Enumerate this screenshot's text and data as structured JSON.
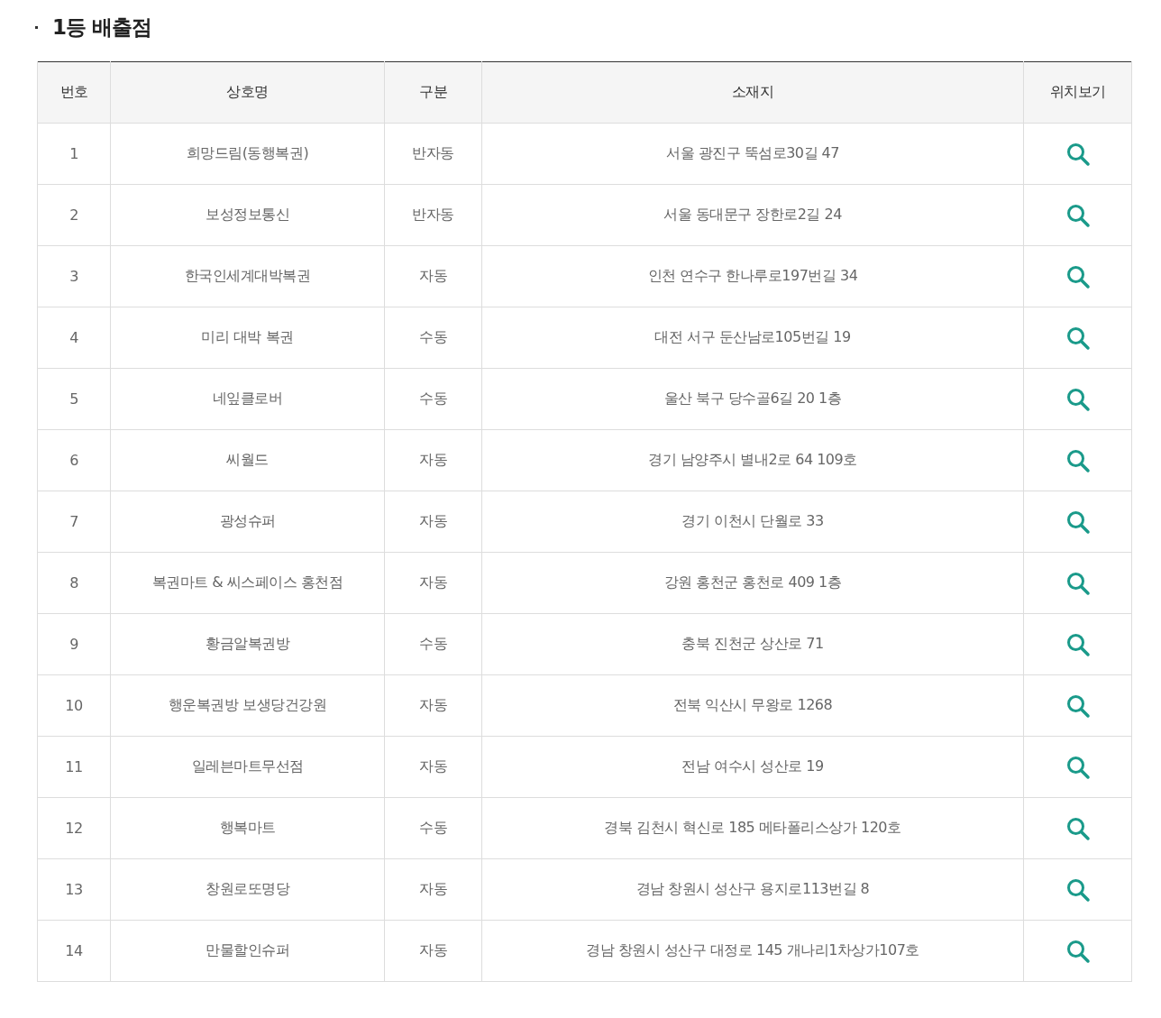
{
  "section_title": "1등 배출점",
  "table": {
    "columns": [
      "번호",
      "상호명",
      "구분",
      "소재지",
      "위치보기"
    ],
    "rows": [
      {
        "number": "1",
        "name": "희망드림(동행복권)",
        "type": "반자동",
        "address": "서울 광진구 뚝섬로30길 47"
      },
      {
        "number": "2",
        "name": "보성정보통신",
        "type": "반자동",
        "address": "서울 동대문구 장한로2길 24"
      },
      {
        "number": "3",
        "name": "한국인세계대박복권",
        "type": "자동",
        "address": "인천 연수구 한나루로197번길 34"
      },
      {
        "number": "4",
        "name": "미리 대박 복권",
        "type": "수동",
        "address": "대전 서구 둔산남로105번길 19"
      },
      {
        "number": "5",
        "name": "네잎클로버",
        "type": "수동",
        "address": "울산 북구 당수골6길 20 1층"
      },
      {
        "number": "6",
        "name": "씨월드",
        "type": "자동",
        "address": "경기 남양주시 별내2로 64 109호"
      },
      {
        "number": "7",
        "name": "광성슈퍼",
        "type": "자동",
        "address": "경기 이천시 단월로 33"
      },
      {
        "number": "8",
        "name": "복권마트 & 씨스페이스 홍천점",
        "type": "자동",
        "address": "강원 홍천군 홍천로 409 1층"
      },
      {
        "number": "9",
        "name": "황금알복권방",
        "type": "수동",
        "address": "충북 진천군 상산로 71"
      },
      {
        "number": "10",
        "name": "행운복권방 보생당건강원",
        "type": "자동",
        "address": "전북 익산시 무왕로 1268"
      },
      {
        "number": "11",
        "name": "일레븐마트무선점",
        "type": "자동",
        "address": "전남 여수시 성산로 19"
      },
      {
        "number": "12",
        "name": "행복마트",
        "type": "수동",
        "address": "경북 김천시 혁신로 185 메타폴리스상가 120호"
      },
      {
        "number": "13",
        "name": "창원로또명당",
        "type": "자동",
        "address": "경남 창원시 성산구 용지로113번길 8"
      },
      {
        "number": "14",
        "name": "만물할인슈퍼",
        "type": "자동",
        "address": "경남 창원시 성산구 대정로 145 개나리1차상가107호"
      }
    ]
  }
}
